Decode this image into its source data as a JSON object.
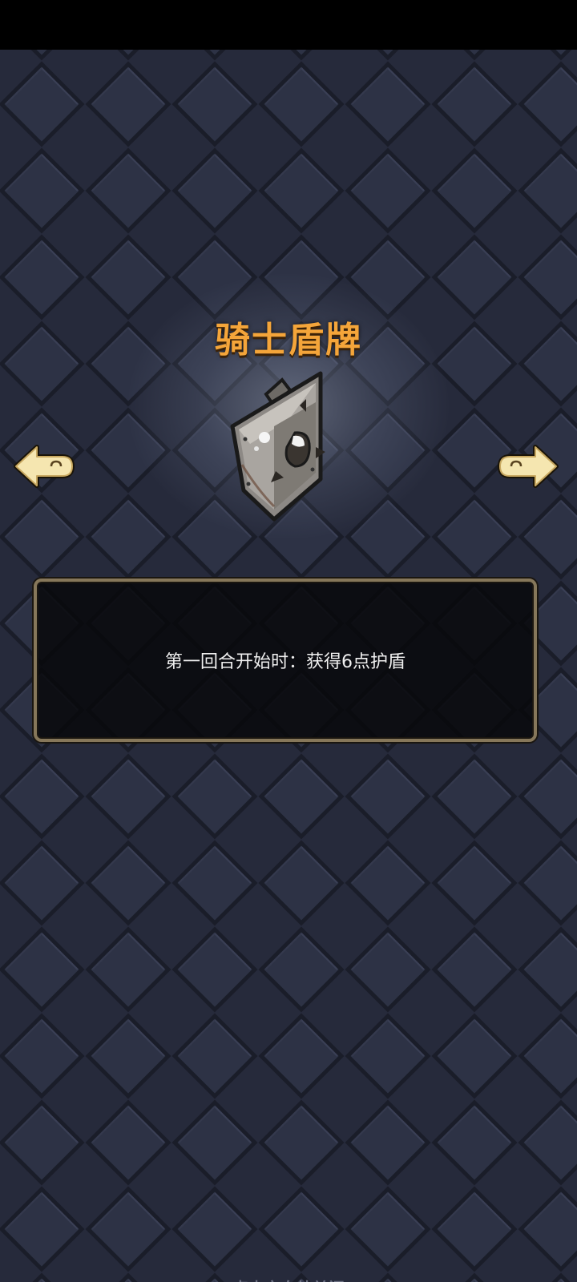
{
  "item": {
    "title": "骑士盾牌",
    "icon": "knight-shield",
    "description": "第一回合开始时：获得6点护盾"
  },
  "navigation": {
    "prev_icon": "arrow-left-icon",
    "next_icon": "arrow-right-icon"
  },
  "footer": {
    "close_hint": "点击空白处关闭"
  },
  "colors": {
    "background": "#262a3b",
    "title": "#f4a53a",
    "panel_border": "#86775a",
    "arrow_fill": "#f5e6b0"
  }
}
